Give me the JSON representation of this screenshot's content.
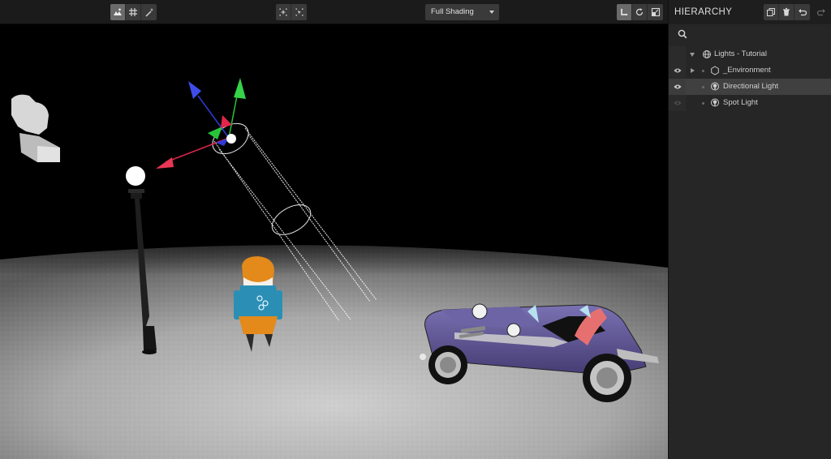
{
  "toolbar": {
    "left_group": [
      {
        "icon": "landscape-icon",
        "active": true
      },
      {
        "icon": "grid-icon",
        "active": false
      },
      {
        "icon": "magic-wand-icon",
        "active": false
      }
    ],
    "center_group": [
      {
        "icon": "frame-focus-icon"
      },
      {
        "icon": "frame-selection-icon"
      }
    ],
    "shading_mode": "Full Shading",
    "transform_group": [
      {
        "icon": "translate-icon",
        "active": true
      },
      {
        "icon": "rotate-icon",
        "active": false
      },
      {
        "icon": "scale-icon",
        "active": false
      }
    ]
  },
  "hierarchy": {
    "title": "HIERARCHY",
    "tools": [
      "duplicate-icon",
      "trash-icon",
      "undo-icon"
    ],
    "redo_icon": "redo-icon",
    "search": {
      "placeholder": "",
      "value": ""
    },
    "items": [
      {
        "label": "Lights - Tutorial",
        "icon": "globe-icon",
        "expanded": true,
        "visible": null
      },
      {
        "label": "_Environment",
        "icon": "hexagon-icon",
        "expanded": false,
        "visible": true
      },
      {
        "label": "Directional Light",
        "icon": "light-icon",
        "selected": true,
        "visible": true
      },
      {
        "label": "Spot Light",
        "icon": "light-icon",
        "visible": false
      }
    ]
  },
  "colors": {
    "panel_bg": "#262626",
    "toolbar_bg": "#1b1b1b",
    "selected_row": "#404040",
    "gizmo_x": "#e0264a",
    "gizmo_y": "#27c43a",
    "gizmo_z": "#2f3bd6",
    "car_body": "#5a4f8f"
  }
}
